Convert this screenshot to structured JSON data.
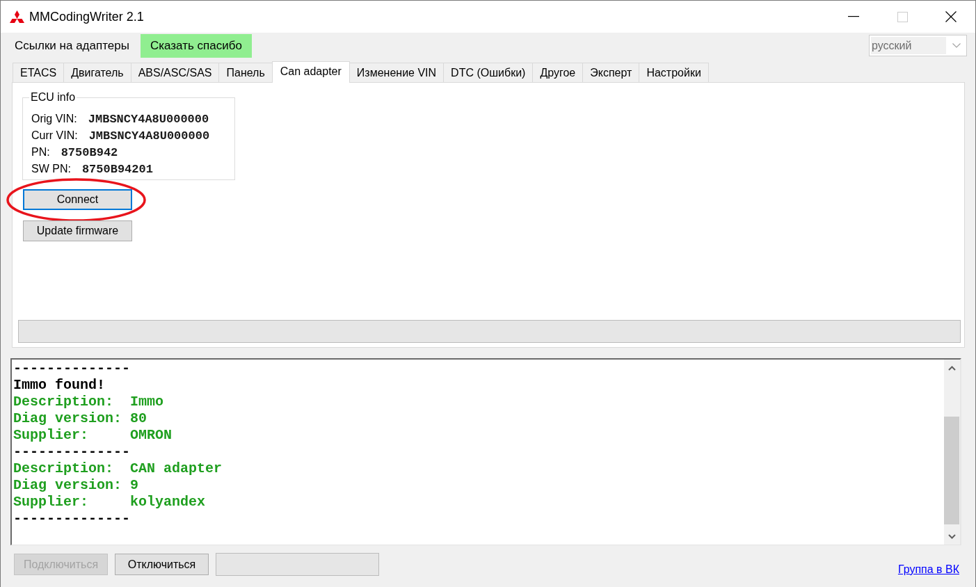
{
  "window": {
    "title": "MMCodingWriter 2.1"
  },
  "menu": {
    "items": [
      {
        "label": "Ссылки на адаптеры",
        "kind": "plain"
      },
      {
        "label": "Сказать спасибо",
        "kind": "accent"
      }
    ],
    "language": {
      "value": "русский",
      "disabled": true
    }
  },
  "tabs": [
    {
      "label": "ETACS",
      "selected": false
    },
    {
      "label": "Двигатель",
      "selected": false
    },
    {
      "label": "ABS/ASC/SAS",
      "selected": false
    },
    {
      "label": "Панель",
      "selected": false
    },
    {
      "label": "Can adapter",
      "selected": true
    },
    {
      "label": "Изменение VIN",
      "selected": false
    },
    {
      "label": "DTC (Ошибки)",
      "selected": false
    },
    {
      "label": "Другое",
      "selected": false
    },
    {
      "label": "Эксперт",
      "selected": false
    },
    {
      "label": "Настройки",
      "selected": false
    }
  ],
  "ecu_info": {
    "title": "ECU info",
    "fields": [
      {
        "label": "Orig VIN:",
        "value": "JMBSNCY4A8U000000"
      },
      {
        "label": "Curr VIN:",
        "value": "JMBSNCY4A8U000000"
      },
      {
        "label": "PN:",
        "value": "8750B942"
      },
      {
        "label": "SW PN:",
        "value": "8750B94201"
      }
    ]
  },
  "buttons": [
    {
      "label": "Connect",
      "focused": true,
      "circled": true
    },
    {
      "label": "Update firmware",
      "focused": false,
      "circled": false
    }
  ],
  "progress": {
    "level": 0
  },
  "log": {
    "lines": [
      {
        "text": "--------------",
        "color": "#000000"
      },
      {
        "text": "Immo found!",
        "color": "#000000"
      },
      {
        "text": "Description:  Immo",
        "color": "#1f9f1f"
      },
      {
        "text": "Diag version: 80",
        "color": "#1f9f1f"
      },
      {
        "text": "Supplier:     OMRON",
        "color": "#1f9f1f"
      },
      {
        "text": "--------------",
        "color": "#000000"
      },
      {
        "text": "Description:  CAN adapter",
        "color": "#1f9f1f"
      },
      {
        "text": "Diag version: 9",
        "color": "#1f9f1f"
      },
      {
        "text": "Supplier:     kolyandex",
        "color": "#1f9f1f"
      },
      {
        "text": "--------------",
        "color": "#000000"
      }
    ]
  },
  "footer": {
    "buttons": [
      {
        "label": "Подключиться",
        "disabled": true
      },
      {
        "label": "Отключиться",
        "disabled": false
      }
    ],
    "status_field": {
      "disabled": true
    },
    "link": "Группа в ВК"
  }
}
